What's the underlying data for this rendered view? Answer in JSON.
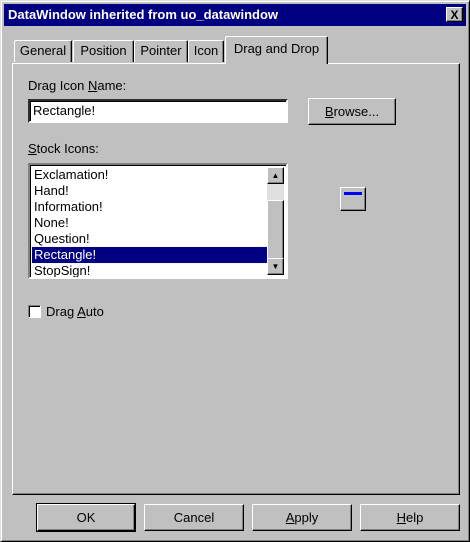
{
  "window": {
    "title": "DataWindow inherited from uo_datawindow",
    "close_label": "X"
  },
  "tabs": [
    {
      "label": "General",
      "active": false
    },
    {
      "label": "Position",
      "active": false
    },
    {
      "label": "Pointer",
      "active": false
    },
    {
      "label": "Icon",
      "active": false
    },
    {
      "label": "Drag and Drop",
      "active": true
    }
  ],
  "drag_icon": {
    "label_prefix": "Drag Icon ",
    "label_underlined": "N",
    "label_suffix": "ame:",
    "value": "Rectangle!",
    "browse_label_underlined": "B",
    "browse_label_rest": "rowse..."
  },
  "stock_icons": {
    "label_underlined": "S",
    "label_rest": "tock Icons:",
    "items": [
      "Exclamation!",
      "Hand!",
      "Information!",
      "None!",
      "Question!",
      "Rectangle!",
      "StopSign!"
    ],
    "selected_index": 5
  },
  "drag_auto": {
    "label_prefix": "Drag ",
    "label_underlined": "A",
    "label_suffix": "uto",
    "checked": false
  },
  "footer": {
    "ok": "OK",
    "cancel": "Cancel",
    "apply_underlined": "A",
    "apply_rest": "pply",
    "help_underlined": "H",
    "help_rest": "elp"
  },
  "colors": {
    "titlebar": "#000080",
    "selection": "#000080",
    "face": "#c0c0c0",
    "preview_bar": "#0000ff"
  },
  "icons": {
    "close": "close-icon",
    "scroll_up": "arrow-up-icon",
    "scroll_down": "arrow-down-icon",
    "preview": "rectangle-drag-icon"
  }
}
